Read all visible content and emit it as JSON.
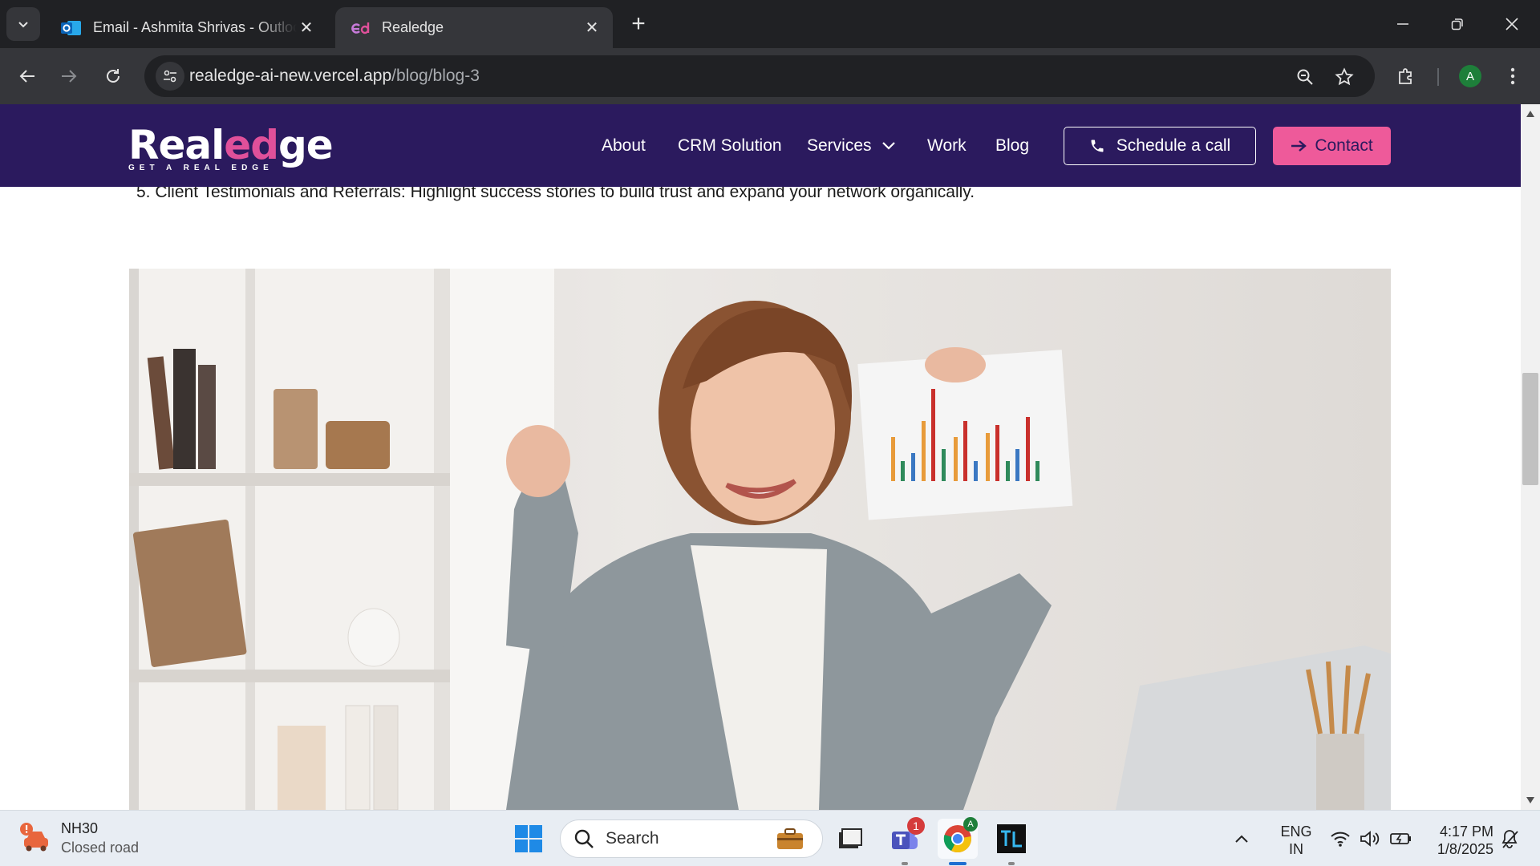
{
  "browser": {
    "tabs": [
      {
        "title": "Email - Ashmita Shrivas - Outlook",
        "active": false
      },
      {
        "title": "Realedge",
        "active": true
      }
    ],
    "url": {
      "host": "realedge-ai-new.vercel.app",
      "path": "/blog/blog-3"
    },
    "profile_initial": "A"
  },
  "site": {
    "logo": {
      "word_start": "Real",
      "word_mid": "ed",
      "word_end": "ge",
      "tagline": "GET A REAL EDGE"
    },
    "nav": {
      "about": "About",
      "crm": "CRM Solution",
      "services": "Services",
      "work": "Work",
      "blog": "Blog"
    },
    "cta": {
      "schedule": "Schedule a call",
      "contact": "Contact"
    },
    "colors": {
      "header": "#2b1a5e",
      "accent": "#ee5a9a"
    }
  },
  "article": {
    "list_item": "5. Client Testimonials and Referrals: Highlight success stories to build trust and expand your network organically."
  },
  "taskbar": {
    "weather_title": "NH30",
    "weather_sub": "Closed road",
    "search_label": "Search",
    "teams_badge": "1",
    "lang_top": "ENG",
    "lang_bottom": "IN",
    "time": "4:17 PM",
    "date": "1/8/2025"
  }
}
